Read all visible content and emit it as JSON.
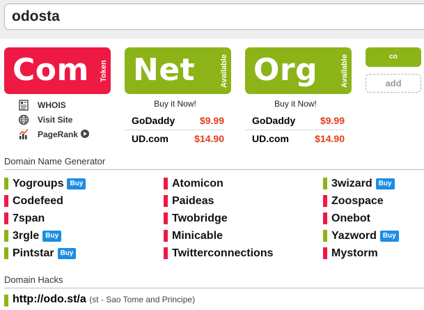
{
  "search": {
    "value": "odosta"
  },
  "tlds": {
    "com": {
      "name": "Com",
      "status": "Token",
      "color": "#ee1a44"
    },
    "net": {
      "name": "Net",
      "status": "Available",
      "color": "#8cb419"
    },
    "org": {
      "name": "Org",
      "status": "Available",
      "color": "#8cb419"
    },
    "co": {
      "name": "co"
    },
    "add_label": "add"
  },
  "com_links": [
    {
      "label": "WHOIS",
      "icon": "whois-icon"
    },
    {
      "label": "Visit Site",
      "icon": "globe-icon"
    },
    {
      "label": "PageRank",
      "icon": "chart-icon"
    }
  ],
  "buy": {
    "net": {
      "title": "Buy it Now!",
      "offers": [
        {
          "registrar": "GoDaddy",
          "price": "$9.99"
        },
        {
          "registrar": "UD.com",
          "price": "$14.90"
        }
      ]
    },
    "org": {
      "title": "Buy it Now!",
      "offers": [
        {
          "registrar": "GoDaddy",
          "price": "$9.99"
        },
        {
          "registrar": "UD.com",
          "price": "$14.90"
        }
      ]
    }
  },
  "generator": {
    "title": "Domain Name Generator",
    "buy_label": "Buy",
    "columns": [
      [
        {
          "name": "Yogroups",
          "status": "green",
          "buy": true
        },
        {
          "name": "Codefeed",
          "status": "red",
          "buy": false
        },
        {
          "name": "7span",
          "status": "red",
          "buy": false
        },
        {
          "name": "3rgle",
          "status": "green",
          "buy": true
        },
        {
          "name": "Pintstar",
          "status": "green",
          "buy": true
        }
      ],
      [
        {
          "name": "Atomicon",
          "status": "red",
          "buy": false
        },
        {
          "name": "Paideas",
          "status": "red",
          "buy": false
        },
        {
          "name": "Twobridge",
          "status": "red",
          "buy": false
        },
        {
          "name": "Minicable",
          "status": "red",
          "buy": false
        },
        {
          "name": "Twitterconnections",
          "status": "red",
          "buy": false
        }
      ],
      [
        {
          "name": "3wizard",
          "status": "green",
          "buy": true
        },
        {
          "name": "Zoospace",
          "status": "red",
          "buy": false
        },
        {
          "name": "Onebot",
          "status": "red",
          "buy": false
        },
        {
          "name": "Yazword",
          "status": "green",
          "buy": true
        },
        {
          "name": "Mystorm",
          "status": "red",
          "buy": false
        }
      ]
    ]
  },
  "hacks": {
    "title": "Domain Hacks",
    "items": [
      {
        "url": "http://odo.st/a",
        "note": "(st - Sao Tome and Principe)"
      }
    ]
  }
}
